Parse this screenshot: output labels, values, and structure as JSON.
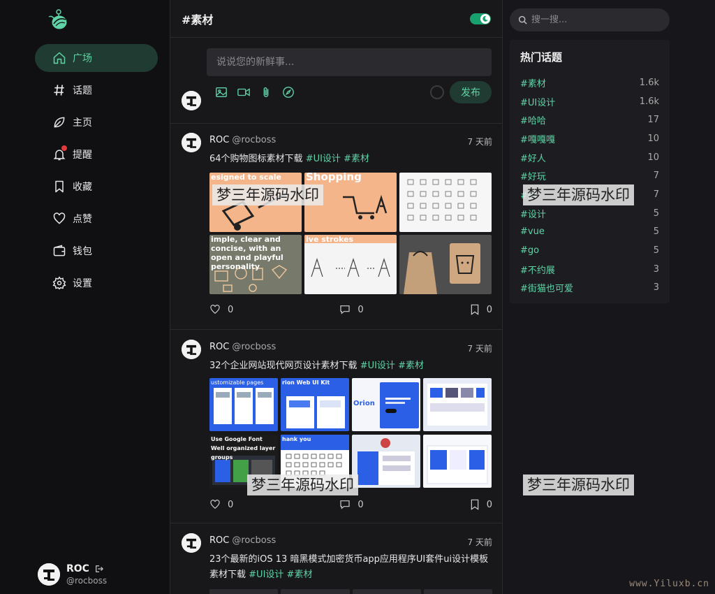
{
  "sidebar": {
    "items": [
      {
        "label": "广场",
        "icon": "home-icon",
        "active": true
      },
      {
        "label": "话题",
        "icon": "hash-icon"
      },
      {
        "label": "主页",
        "icon": "leaf-icon"
      },
      {
        "label": "提醒",
        "icon": "bell-icon",
        "badge": true
      },
      {
        "label": "收藏",
        "icon": "bookmark-icon"
      },
      {
        "label": "点赞",
        "icon": "heart-icon"
      },
      {
        "label": "钱包",
        "icon": "wallet-icon"
      },
      {
        "label": "设置",
        "icon": "gear-icon"
      }
    ],
    "user": {
      "name": "ROC",
      "handle": "@rocboss"
    }
  },
  "header": {
    "title": "#素材"
  },
  "compose": {
    "placeholder": "说说您的新鲜事...",
    "publish_label": "发布"
  },
  "posts": [
    {
      "name": "ROC",
      "handle": "@rocboss",
      "time": "7 天前",
      "text": "64个购物图标素材下载",
      "tags": [
        "#UI设计",
        "#素材"
      ],
      "image_captions": [
        "esigned to scale",
        "Shopping",
        "",
        "imple, clear and concise, with an open and playful personality",
        "ive strokes",
        ""
      ],
      "likes": "0",
      "comments": "0",
      "collects": "0"
    },
    {
      "name": "ROC",
      "handle": "@rocboss",
      "time": "7 天前",
      "text": "32个企业网站现代网页设计素材下载",
      "tags": [
        "#UI设计",
        "#素材"
      ],
      "image_captions": [
        "ustomizable pages",
        "rion Web UI Kit",
        "Orion",
        "",
        "Use Google Font Well organized layer groups",
        "hank you",
        "",
        ""
      ],
      "likes": "0",
      "comments": "0",
      "collects": "0"
    },
    {
      "name": "ROC",
      "handle": "@rocboss",
      "time": "7 天前",
      "text": "23个最新的iOS 13 暗黑模式加密货币app应用程序UI套件ui设计模板素材下载",
      "tags": [
        "#UI设计",
        "#素材"
      ]
    }
  ],
  "search": {
    "placeholder": "搜一搜..."
  },
  "topics": {
    "title": "热门话题",
    "items": [
      {
        "name": "#素材",
        "count": "1.6k"
      },
      {
        "name": "#UI设计",
        "count": "1.6k"
      },
      {
        "name": "#哈哈",
        "count": "17"
      },
      {
        "name": "#嘎嘎嘎",
        "count": "10"
      },
      {
        "name": "#好人",
        "count": "10"
      },
      {
        "name": "#好玩",
        "count": "7"
      },
      {
        "name": "#图",
        "count": "7"
      },
      {
        "name": "#设计",
        "count": "5"
      },
      {
        "name": "#vue",
        "count": "5"
      },
      {
        "name": "#go",
        "count": "5"
      },
      {
        "name": "#不约展",
        "count": "3"
      },
      {
        "name": "#街猫也可爱",
        "count": "3"
      }
    ]
  },
  "watermarks": {
    "text": "梦三年源码水印",
    "site": "www.Yiluxb.cn"
  },
  "colors": {
    "accent": "#5fd3a6",
    "accent_bg": "#203c32",
    "background": "#17171b",
    "toggle": "#18a06e"
  }
}
